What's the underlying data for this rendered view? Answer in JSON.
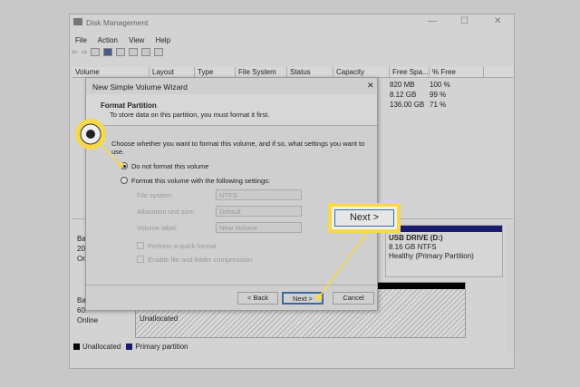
{
  "window": {
    "title": "Disk Management",
    "minimize": "—",
    "maximize": "☐",
    "close": "✕"
  },
  "menu": [
    "File",
    "Action",
    "View",
    "Help"
  ],
  "toolbar_icons": [
    "back-icon",
    "forward-icon",
    "console-icon",
    "help-icon",
    "properties-icon",
    "disk-icon",
    "check-icon",
    "list-icon"
  ],
  "table": {
    "headers": [
      "Volume",
      "Layout",
      "Type",
      "File System",
      "Status",
      "Capacity",
      "Free Spa...",
      "% Free"
    ],
    "rows": [
      {
        "free": "820 MB",
        "pct": "100 %"
      },
      {
        "free": "8.12 GB",
        "pct": "99 %"
      },
      {
        "free": "136.00 GB",
        "pct": "71 %"
      }
    ]
  },
  "disks": [
    {
      "l1": "Ba",
      "l2": "20",
      "l3": "Or"
    },
    {
      "l1": "Ba",
      "l2": "60.",
      "l3": "Online"
    }
  ],
  "usb": {
    "name": "USB DRIVE  (D:)",
    "size": "8.16 GB NTFS",
    "status": "Healthy (Primary Partition)"
  },
  "unallocated_label": "Unallocated",
  "legend": [
    {
      "label": "Unallocated",
      "color": "#000000"
    },
    {
      "label": "Primary partition",
      "color": "#1a1a6e"
    }
  ],
  "dialog": {
    "title": "New Simple Volume Wizard",
    "close": "✕",
    "heading": "Format Partition",
    "subheading": "To store data on this partition, you must format it first.",
    "prompt": "Choose whether you want to format this volume, and if so, what settings you want to use.",
    "opt_no": "Do not format this volume",
    "opt_yes": "Format this volume with the following settings:",
    "fs_label": "File system:",
    "fs_value": "NTFS",
    "alloc_label": "Allocation unit size:",
    "alloc_value": "Default",
    "vol_label": "Volume label:",
    "vol_value": "New Volume",
    "quick": "Perform a quick format",
    "compress": "Enable file and folder compression",
    "back": "< Back",
    "next": "Next >",
    "cancel": "Cancel"
  },
  "callout": {
    "next": "Next >",
    "color": "#f5d94a"
  }
}
